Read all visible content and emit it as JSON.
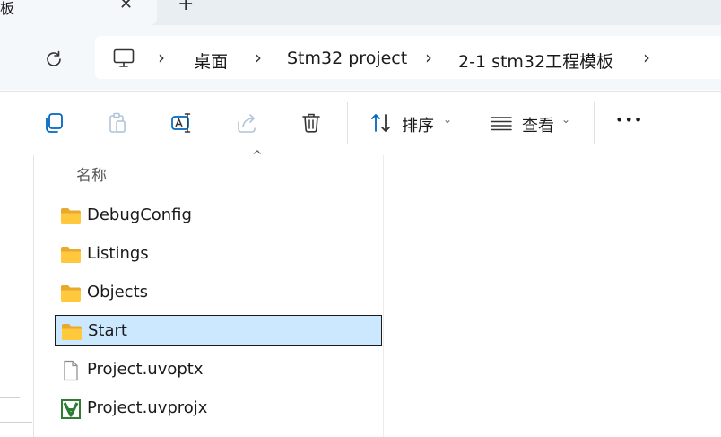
{
  "tab": {
    "title": "板",
    "close_glyph": "✕",
    "new_glyph": "+"
  },
  "address": {
    "segments": [
      "桌面",
      "Stm32 project",
      "2-1 stm32工程模板"
    ],
    "separator": "›"
  },
  "toolbar": {
    "sort_label": "排序",
    "view_label": "查看",
    "more_glyph": "•••",
    "caret": "⌄"
  },
  "list": {
    "header_name": "名称",
    "sort_indicator": "^",
    "items": [
      {
        "name": "DebugConfig",
        "icon": "folder-icon",
        "selected": false
      },
      {
        "name": "Listings",
        "icon": "folder-icon",
        "selected": false
      },
      {
        "name": "Objects",
        "icon": "folder-icon",
        "selected": false
      },
      {
        "name": "Start",
        "icon": "folder-icon",
        "selected": true
      },
      {
        "name": "Project.uvoptx",
        "icon": "file-icon",
        "selected": false
      },
      {
        "name": "Project.uvprojx",
        "icon": "keil-project-icon",
        "selected": false
      }
    ]
  },
  "colors": {
    "accent": "#0067c0",
    "selection": "#cce8ff",
    "folder": "#ffc83d"
  }
}
